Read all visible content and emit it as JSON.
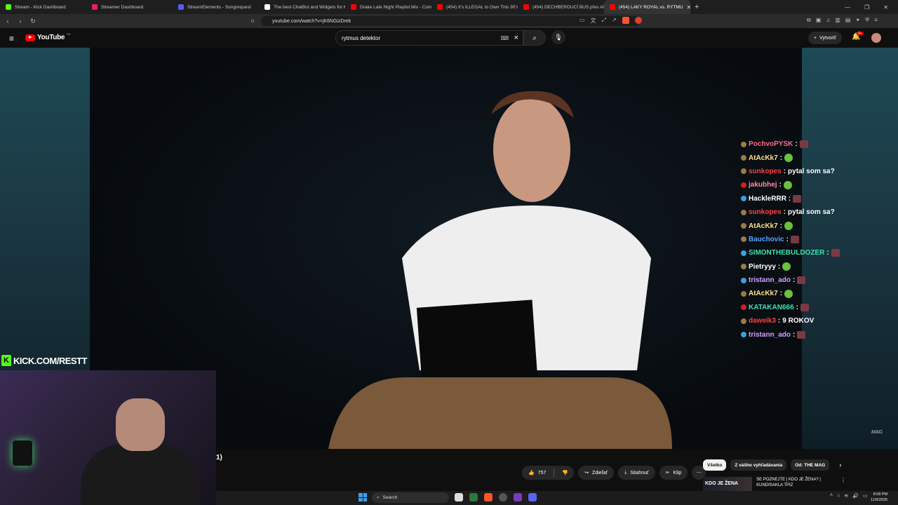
{
  "tabs": [
    {
      "label": "Stream - Kick Dashboard",
      "color": "#53fc18"
    },
    {
      "label": "Streamer Dashboard",
      "color": "#e91e63"
    },
    {
      "label": "StreamElements - Songrequest",
      "color": "#5b5bf0"
    },
    {
      "label": "The best ChatBot and Widgets for K",
      "color": "#ffffff"
    },
    {
      "label": "Drake Late Night Playlist Mix - Comp",
      "color": "#ff0000"
    },
    {
      "label": "(454) It's ILLEGAL to Own This 90's H",
      "color": "#ff0000"
    },
    {
      "label": "(454) DECHBEROUCÍ BUS přes ANDY",
      "color": "#ff0000"
    },
    {
      "label": "(454) LAKY ROYAL vs. RYTMU",
      "color": "#ff0000",
      "active": true
    }
  ],
  "address": {
    "url": "youtube.com/watch?v=jK6NGizDrek"
  },
  "youtube": {
    "logo_text": "YouTube",
    "region": "SK",
    "search_value": "rytmus detektor",
    "create_label": "Vytvoriť",
    "notif_count": "9+"
  },
  "video": {
    "watermark": "MAG"
  },
  "chat": [
    {
      "user": "PochvoPYSK",
      "color": "#ff6a8a",
      "msg": "",
      "emote": "red",
      "badge": "#9a7a4a"
    },
    {
      "user": "AtAcKk7",
      "color": "#ffe08a",
      "msg": "",
      "emote": "green",
      "badge": "#9a7a4a"
    },
    {
      "user": "sunkopes",
      "color": "#ff4040",
      "msg": "pytal som sa?",
      "emote": "",
      "badge": "#9a7a4a"
    },
    {
      "user": "jakubhej",
      "color": "#ff8aa0",
      "msg": "",
      "emote": "green",
      "badge": "#d02020"
    },
    {
      "user": "HackleRRR",
      "color": "#ffffff",
      "msg": "",
      "emote": "red",
      "badge": "#3aa0e0"
    },
    {
      "user": "sunkopes",
      "color": "#ff4040",
      "msg": "pytal som sa?",
      "emote": "",
      "badge": "#9a7a4a"
    },
    {
      "user": "AtAcKk7",
      "color": "#ffe08a",
      "msg": "",
      "emote": "green",
      "badge": "#9a7a4a"
    },
    {
      "user": "Bauchovic",
      "color": "#5aa0ff",
      "msg": "",
      "emote": "red",
      "badge": "#9a7a4a"
    },
    {
      "user": "SIMONTHEBULDOZER",
      "color": "#40e0b0",
      "msg": "",
      "emote": "red",
      "badge": "#3aa0e0"
    },
    {
      "user": "Pietryyy",
      "color": "#ffffff",
      "msg": "",
      "emote": "green",
      "badge": "#9a7a4a"
    },
    {
      "user": "tristann_ado",
      "color": "#d0a0ff",
      "msg": "",
      "emote": "red",
      "badge": "#3aa0e0"
    },
    {
      "user": "AtAcKk7",
      "color": "#ffe08a",
      "msg": "",
      "emote": "green",
      "badge": "#9a7a4a"
    },
    {
      "user": "KATAKAN666",
      "color": "#40e0b0",
      "msg": "",
      "emote": "red",
      "badge": "#d02020"
    },
    {
      "user": "daweik3",
      "color": "#ff4040",
      "msg": "9 ROKOV",
      "emote": "",
      "badge": "#9a7a4a"
    },
    {
      "user": "tristann_ado",
      "color": "#d0a0ff",
      "msg": "",
      "emote": "red",
      "badge": "#3aa0e0"
    }
  ],
  "overlay": {
    "kick_url": "KICK.COM/RESTT"
  },
  "below": {
    "title_fragment": "1)",
    "likes": "757",
    "share_label": "Zdieľať",
    "download_label": "Stiahnuť",
    "clip_label": "Klip",
    "chips": [
      "Všetko",
      "Z vášho vyhľadávania",
      "Od: THE MAG"
    ],
    "rec_thumb_text": "KDO JE ŽENA",
    "rec_title": "SE POZNEJTE | KDO JE ŽENA? | KUNDISAKLA TPIZ"
  },
  "taskbar": {
    "search_placeholder": "Search",
    "time": "8:58 PM",
    "date": "11/9/2025"
  }
}
